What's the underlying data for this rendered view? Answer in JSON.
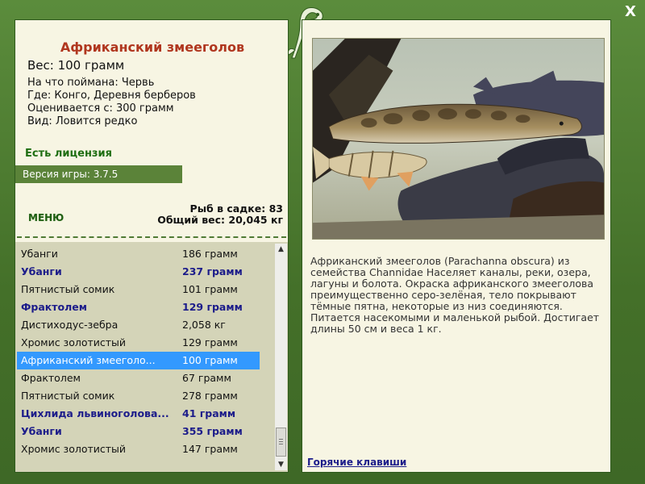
{
  "fish": {
    "title": "Африканский змееголов",
    "weight": "Вес: 100 грамм",
    "bait": "На что поймана: Червь",
    "location": "Где: Конго, Деревня берберов",
    "value": "Оценивается с: 300 грамм",
    "kind": "Вид: Ловится редко"
  },
  "license": "Есть лицензия",
  "version": "Версия игры: 3.7.5",
  "menu_label": "МЕНЮ",
  "stats": {
    "count": "Рыб в садке: 83",
    "total_weight": "Общий вес: 20,045 кг"
  },
  "catch_list": [
    {
      "name": "Убанги",
      "weight": "186 грамм",
      "bold": false,
      "selected": false
    },
    {
      "name": "Убанги",
      "weight": "237 грамм",
      "bold": true,
      "selected": false
    },
    {
      "name": "Пятнистый сомик",
      "weight": "101 грамм",
      "bold": false,
      "selected": false
    },
    {
      "name": "Фрактолем",
      "weight": "129 грамм",
      "bold": true,
      "selected": false
    },
    {
      "name": "Дистиходус-зебра",
      "weight": "2,058 кг",
      "bold": false,
      "selected": false
    },
    {
      "name": "Хромис золотистый",
      "weight": "129 грамм",
      "bold": false,
      "selected": false
    },
    {
      "name": "Африканский змееголо...",
      "weight": "100 грамм",
      "bold": false,
      "selected": true
    },
    {
      "name": "Фрактолем",
      "weight": "67 грамм",
      "bold": false,
      "selected": false
    },
    {
      "name": "Пятнистый сомик",
      "weight": "278 грамм",
      "bold": false,
      "selected": false
    },
    {
      "name": "Цихлида львиноголова...",
      "weight": "41 грамм",
      "bold": true,
      "selected": false
    },
    {
      "name": "Убанги",
      "weight": "355 грамм",
      "bold": true,
      "selected": false
    },
    {
      "name": "Хромис золотистый",
      "weight": "147 грамм",
      "bold": false,
      "selected": false
    }
  ],
  "description": "Африканский змееголов (Parachanna obscura) из семейства Channidae Населяет каналы, реки, озера, лагуны и болота. Окраска африканского змееголова преимущественно серо-зелёная, тело покрывают тёмные пятна, некоторые из низ соединяются. Питается насекомыми и маленькой рыбой. Достигает длины 50 см и веса 1 кг.",
  "hotkeys_label": "Горячие клавиши",
  "close_label": "X",
  "colors": {
    "frame_green": "#4a7a32",
    "panel_bg": "#f7f5e3",
    "title_red": "#b0361e",
    "license_green": "#1f6e12",
    "selected_blue": "#3399ff",
    "bold_navy": "#1c1c8a"
  }
}
